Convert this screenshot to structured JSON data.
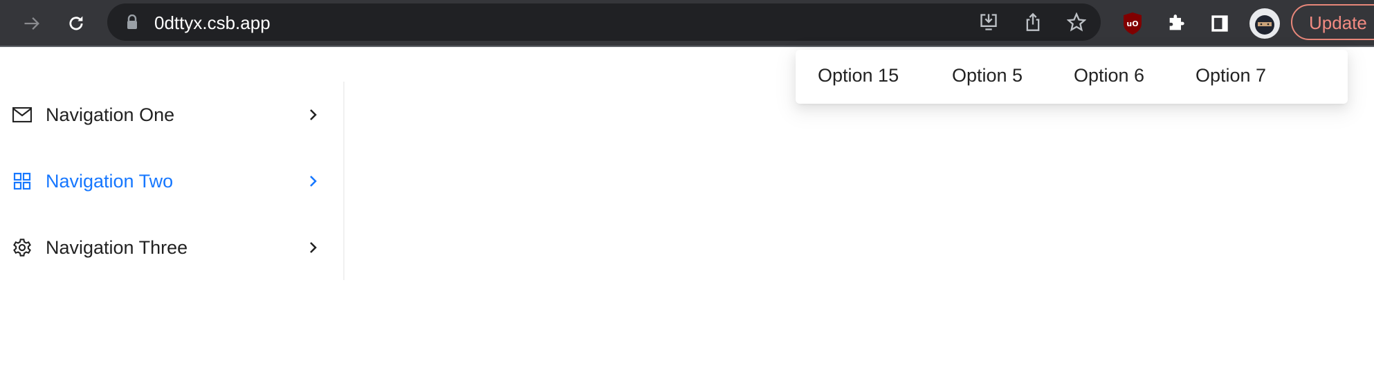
{
  "browser": {
    "url": "0dttyx.csb.app",
    "update_label": "Update",
    "icons": [
      "forward-icon",
      "reload-icon",
      "lock-icon",
      "install-icon",
      "share-icon",
      "star-icon",
      "ublock-icon",
      "extensions-icon",
      "sidebar-icon",
      "profile-avatar"
    ]
  },
  "sidebar": {
    "items": [
      {
        "label": "Navigation One",
        "icon": "mail-icon",
        "active": false
      },
      {
        "label": "Navigation Two",
        "icon": "appstore-icon",
        "active": true
      },
      {
        "label": "Navigation Three",
        "icon": "setting-icon",
        "active": false
      }
    ]
  },
  "submenu": {
    "options": [
      "Option 15",
      "Option 5",
      "Option 6",
      "Option 7"
    ]
  },
  "colors": {
    "accent": "#1677ff",
    "toolbar": "#35363a",
    "update": "#f28b82"
  }
}
